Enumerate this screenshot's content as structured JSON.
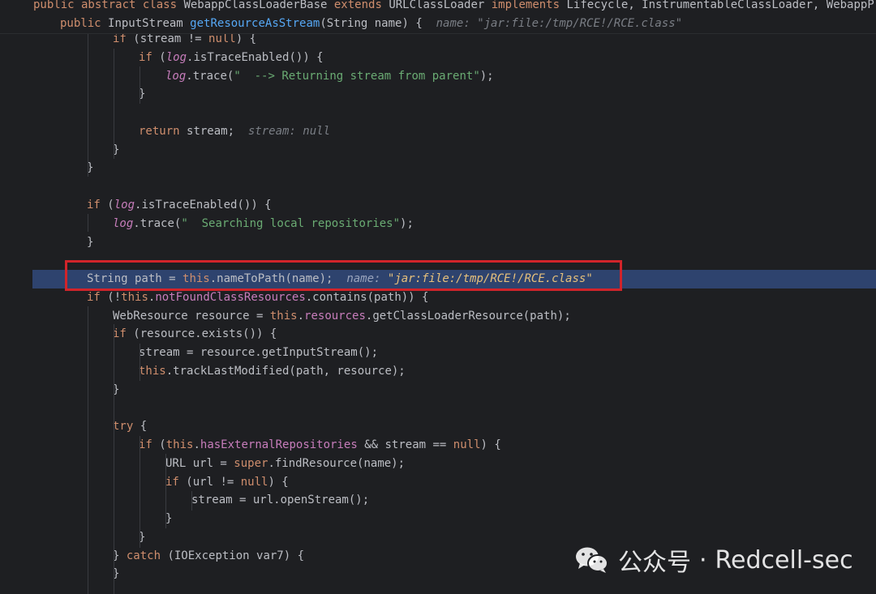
{
  "editor": {
    "sticky_header": {
      "class_decl": [
        {
          "t": "public abstract class ",
          "c": "kw"
        },
        {
          "t": "WebappClassLoaderBase ",
          "c": "p"
        },
        {
          "t": "extends ",
          "c": "kw"
        },
        {
          "t": "URLClassLoader ",
          "c": "p"
        },
        {
          "t": "implements ",
          "c": "kw"
        },
        {
          "t": "Lifecycle, InstrumentableClassLoader, WebappProper",
          "c": "p"
        }
      ],
      "method_decl": [
        {
          "t": "public ",
          "c": "kw"
        },
        {
          "t": "InputStream ",
          "c": "p"
        },
        {
          "t": "getResourceAsStream",
          "c": "fn"
        },
        {
          "t": "(String name) {  ",
          "c": "p"
        },
        {
          "t": "name: \"jar:file:/tmp/RCE!/RCE.class\"",
          "c": "hint"
        }
      ]
    },
    "lines": [
      [
        {
          "t": "if ",
          "c": "kw"
        },
        {
          "t": "(stream != ",
          "c": "p"
        },
        {
          "t": "null",
          "c": "kw"
        },
        {
          "t": ") {",
          "c": "p"
        }
      ],
      [
        {
          "t": "if ",
          "c": "kw"
        },
        {
          "t": "(",
          "c": "p"
        },
        {
          "t": "log",
          "c": "stat"
        },
        {
          "t": ".isTraceEnabled()) {",
          "c": "p"
        }
      ],
      [
        {
          "t": "log",
          "c": "stat"
        },
        {
          "t": ".trace(",
          "c": "p"
        },
        {
          "t": "\"  --> Returning stream from parent\"",
          "c": "str"
        },
        {
          "t": ");",
          "c": "p"
        }
      ],
      [
        {
          "t": "}",
          "c": "p"
        }
      ],
      [],
      [
        {
          "t": "return ",
          "c": "kw"
        },
        {
          "t": "stream;  ",
          "c": "p"
        },
        {
          "t": "stream: null",
          "c": "hint"
        }
      ],
      [
        {
          "t": "}",
          "c": "p"
        }
      ],
      [
        {
          "t": "}",
          "c": "p"
        }
      ],
      [],
      [
        {
          "t": "if ",
          "c": "kw"
        },
        {
          "t": "(",
          "c": "p"
        },
        {
          "t": "log",
          "c": "stat"
        },
        {
          "t": ".isTraceEnabled()) {",
          "c": "p"
        }
      ],
      [
        {
          "t": "log",
          "c": "stat"
        },
        {
          "t": ".trace(",
          "c": "p"
        },
        {
          "t": "\"  Searching local repositories\"",
          "c": "str"
        },
        {
          "t": ");",
          "c": "p"
        }
      ],
      [
        {
          "t": "}",
          "c": "p"
        }
      ],
      [],
      [
        {
          "t": "String path = ",
          "c": "p"
        },
        {
          "t": "this",
          "c": "kw"
        },
        {
          "t": ".nameToPath(name);  ",
          "c": "p"
        },
        {
          "t": "name: ",
          "c": "hint-cur"
        },
        {
          "t": "\"jar:file:/tmp/RCE!/RCE.class\"",
          "c": "hint-str"
        }
      ],
      [
        {
          "t": "if ",
          "c": "kw"
        },
        {
          "t": "(!",
          "c": "p"
        },
        {
          "t": "this",
          "c": "kw"
        },
        {
          "t": ".",
          "c": "p"
        },
        {
          "t": "notFoundClassResources",
          "c": "fld"
        },
        {
          "t": ".contains(path)) {",
          "c": "p"
        }
      ],
      [
        {
          "t": "WebResource resource = ",
          "c": "p"
        },
        {
          "t": "this",
          "c": "kw"
        },
        {
          "t": ".",
          "c": "p"
        },
        {
          "t": "resources",
          "c": "fld"
        },
        {
          "t": ".getClassLoaderResource(path);",
          "c": "p"
        }
      ],
      [
        {
          "t": "if ",
          "c": "kw"
        },
        {
          "t": "(resource.exists()) {",
          "c": "p"
        }
      ],
      [
        {
          "t": "stream = resource.getInputStream();",
          "c": "p"
        }
      ],
      [
        {
          "t": "this",
          "c": "kw"
        },
        {
          "t": ".trackLastModified(path, resource);",
          "c": "p"
        }
      ],
      [
        {
          "t": "}",
          "c": "p"
        }
      ],
      [],
      [
        {
          "t": "try ",
          "c": "kw"
        },
        {
          "t": "{",
          "c": "p"
        }
      ],
      [
        {
          "t": "if ",
          "c": "kw"
        },
        {
          "t": "(",
          "c": "p"
        },
        {
          "t": "this",
          "c": "kw"
        },
        {
          "t": ".",
          "c": "p"
        },
        {
          "t": "hasExternalRepositories",
          "c": "fld"
        },
        {
          "t": " && stream == ",
          "c": "p"
        },
        {
          "t": "null",
          "c": "kw"
        },
        {
          "t": ") {",
          "c": "p"
        }
      ],
      [
        {
          "t": "URL url = ",
          "c": "p"
        },
        {
          "t": "super",
          "c": "kw"
        },
        {
          "t": ".findResource(name);",
          "c": "p"
        }
      ],
      [
        {
          "t": "if ",
          "c": "kw"
        },
        {
          "t": "(url != ",
          "c": "p"
        },
        {
          "t": "null",
          "c": "kw"
        },
        {
          "t": ") {",
          "c": "p"
        }
      ],
      [
        {
          "t": "stream = url.openStream();",
          "c": "p"
        }
      ],
      [
        {
          "t": "}",
          "c": "p"
        }
      ],
      [
        {
          "t": "}",
          "c": "p"
        }
      ],
      [
        {
          "t": "} ",
          "c": "p"
        },
        {
          "t": "catch ",
          "c": "kw"
        },
        {
          "t": "(IOException var7) {",
          "c": "p"
        }
      ],
      [
        {
          "t": "}",
          "c": "p"
        }
      ]
    ]
  },
  "watermark": {
    "channel_label": "公众号",
    "separator": "·",
    "account": "Redcell-sec"
  }
}
